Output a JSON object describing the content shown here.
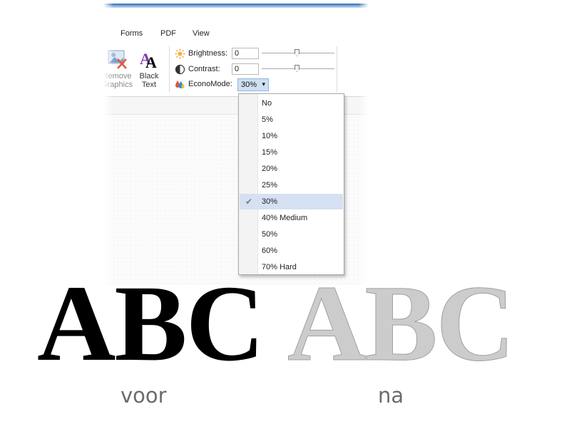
{
  "menu": {
    "items": [
      "Forms",
      "PDF",
      "View"
    ]
  },
  "ribbon": {
    "buttons": [
      {
        "label_line1": "Remove",
        "label_line2": "Graphics",
        "icon": "remove-graphics-icon"
      },
      {
        "label_line1": "Black",
        "label_line2": "Text",
        "icon": "black-text-icon"
      }
    ],
    "brightness": {
      "label": "Brightness:",
      "value": "0",
      "icon": "sun-icon"
    },
    "contrast": {
      "label": "Contrast:",
      "value": "0",
      "icon": "contrast-icon"
    },
    "econo_mode": {
      "label": "EconoMode:",
      "value": "30%",
      "icon": "ink-drops-icon"
    }
  },
  "dropdown": {
    "options": [
      "No",
      "5%",
      "10%",
      "15%",
      "20%",
      "25%",
      "30%",
      "40% Medium",
      "50%",
      "60%",
      "70% Hard"
    ],
    "selected": "30%"
  },
  "comparison": {
    "sample_text": "ABC",
    "before_caption": "voor",
    "after_caption": "na",
    "before_color": "#000000",
    "after_color": "#cccccc"
  }
}
